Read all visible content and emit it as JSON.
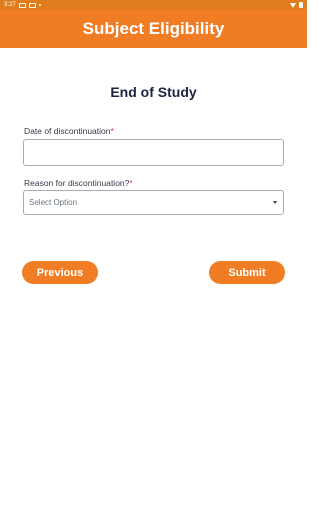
{
  "status_bar": {
    "time": "3:27"
  },
  "app_bar": {
    "title": "Subject Eligibility"
  },
  "form": {
    "section_title": "End of Study",
    "date_field": {
      "label": "Date of discontinuation",
      "required_marker": "*",
      "value": ""
    },
    "reason_field": {
      "label": "Reason for discontinuation?",
      "required_marker": "*",
      "selected": "Select Option"
    }
  },
  "buttons": {
    "previous": "Previous",
    "submit": "Submit"
  }
}
